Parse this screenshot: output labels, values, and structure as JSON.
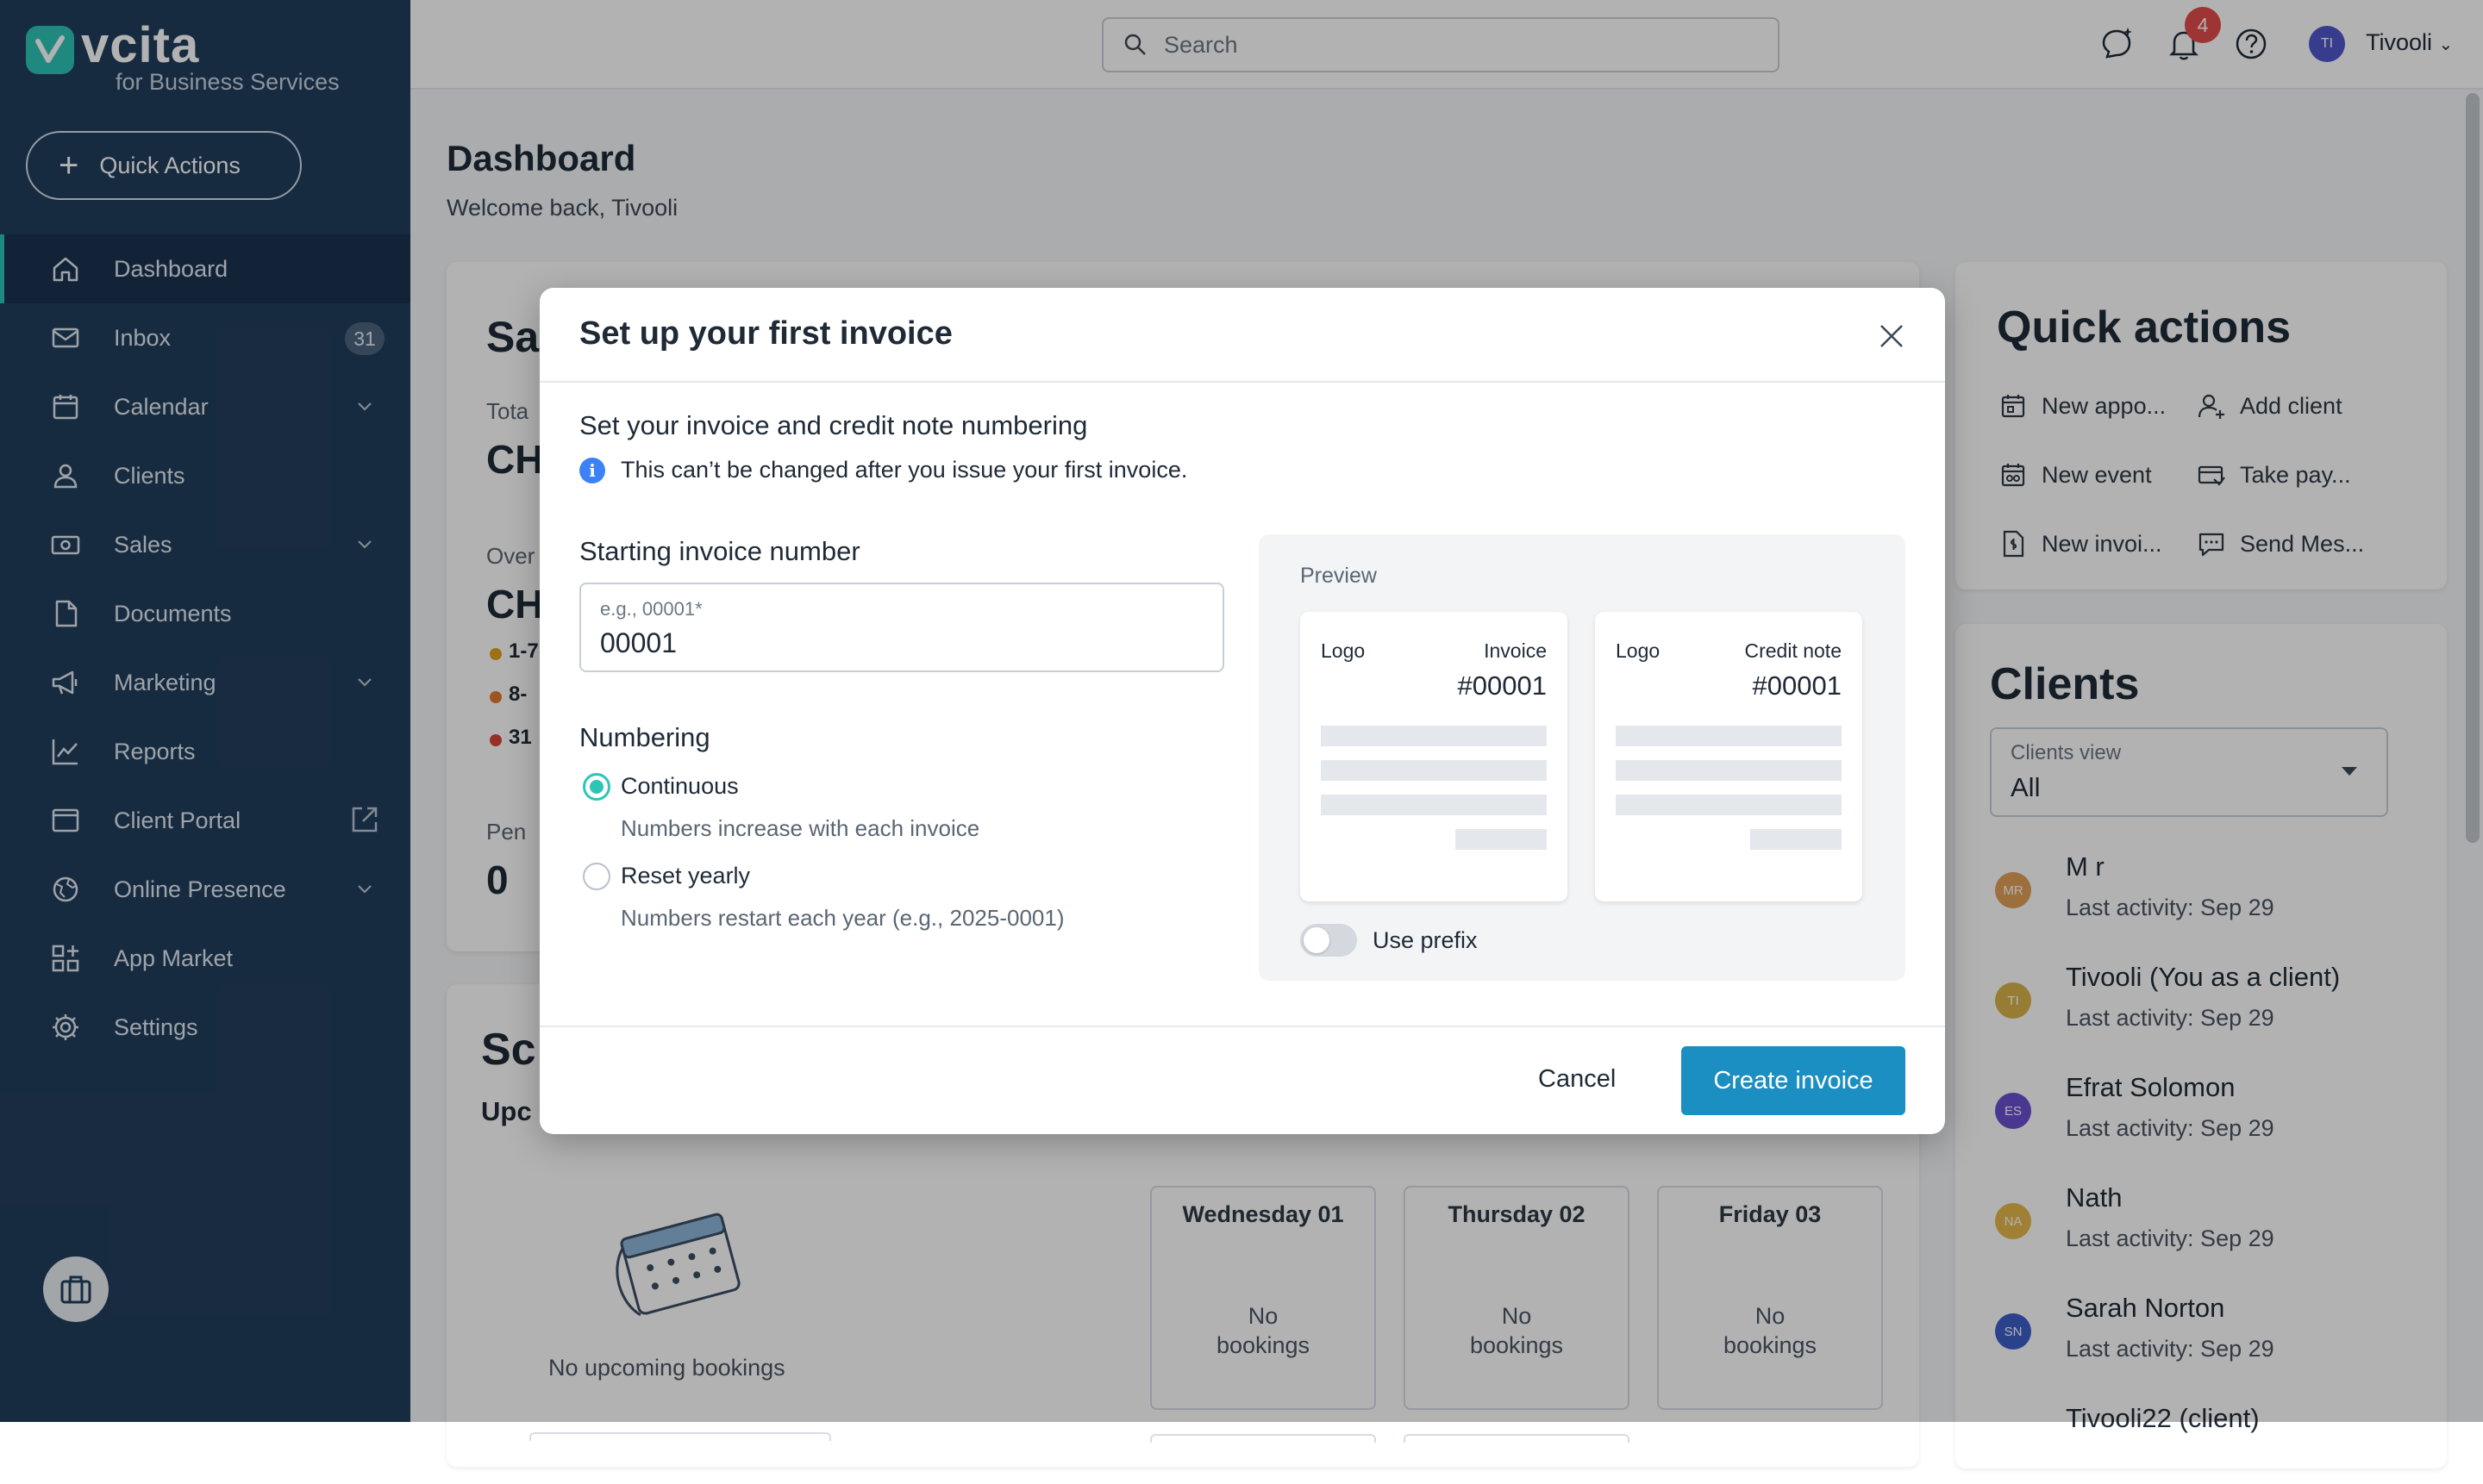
{
  "brand": {
    "name": "vcita",
    "subtitle": "for Business Services"
  },
  "sidebar": {
    "quick_actions": "Quick Actions",
    "items": [
      {
        "label": "Dashboard",
        "icon": "home-icon",
        "active": true
      },
      {
        "label": "Inbox",
        "icon": "inbox-icon",
        "badge": "31"
      },
      {
        "label": "Calendar",
        "icon": "calendar-icon",
        "expandable": true
      },
      {
        "label": "Clients",
        "icon": "person-icon"
      },
      {
        "label": "Sales",
        "icon": "money-icon",
        "expandable": true
      },
      {
        "label": "Documents",
        "icon": "document-icon"
      },
      {
        "label": "Marketing",
        "icon": "megaphone-icon",
        "expandable": true
      },
      {
        "label": "Reports",
        "icon": "chart-line-icon"
      },
      {
        "label": "Client Portal",
        "icon": "portal-icon",
        "external": true
      },
      {
        "label": "Online Presence",
        "icon": "globe-icon",
        "expandable": true
      },
      {
        "label": "App Market",
        "icon": "apps-icon"
      },
      {
        "label": "Settings",
        "icon": "gear-icon"
      }
    ]
  },
  "topbar": {
    "search_placeholder": "Search",
    "notifications_count": "4",
    "user_initials": "TI",
    "user_name": "Tivooli"
  },
  "dashboard": {
    "title": "Dashboard",
    "welcome": "Welcome back, Tivooli",
    "sales": {
      "title": "Sa",
      "total_label": "Tota",
      "total_value": "CH",
      "overdue_label": "Over",
      "overdue_value": "CH",
      "legend": [
        {
          "label": "1-7",
          "color": "#e0a21d"
        },
        {
          "label": "8-",
          "color": "#e07a2e"
        },
        {
          "label": "31",
          "color": "#d9443b"
        }
      ],
      "pending_label": "Pen",
      "pending_value": "0"
    },
    "schedule": {
      "title": "Sc",
      "subtitle": "Upc",
      "no_upcoming": "No upcoming bookings",
      "days": [
        {
          "name": "Wednesday 01",
          "empty_line1": "No",
          "empty_line2": "bookings"
        },
        {
          "name": "Thursday 02",
          "empty_line1": "No",
          "empty_line2": "bookings"
        },
        {
          "name": "Friday 03",
          "empty_line1": "No",
          "empty_line2": "bookings"
        }
      ]
    },
    "quick_actions": {
      "title": "Quick actions",
      "items": [
        {
          "label": "New appo...",
          "icon": "calendar-icon"
        },
        {
          "label": "Add client",
          "icon": "add-person-icon"
        },
        {
          "label": "New event",
          "icon": "event-icon"
        },
        {
          "label": "Take pay...",
          "icon": "payment-icon"
        },
        {
          "label": "New invoi...",
          "icon": "invoice-icon"
        },
        {
          "label": "Send Mes...",
          "icon": "message-icon"
        }
      ]
    },
    "clients": {
      "title": "Clients",
      "view_label": "Clients view",
      "view_value": "All",
      "list": [
        {
          "initials": "MR",
          "name": "M r",
          "activity": "Last activity: Sep 29",
          "color": "#e0a056"
        },
        {
          "initials": "TI",
          "name": "Tivooli (You as a client)",
          "activity": "Last activity: Sep 29",
          "color": "#d9b24a"
        },
        {
          "initials": "ES",
          "name": "Efrat Solomon",
          "activity": "Last activity: Sep 29",
          "color": "#6b4fcf"
        },
        {
          "initials": "NA",
          "name": "Nath",
          "activity": "Last activity: Sep 29",
          "color": "#e6b84d"
        },
        {
          "initials": "SN",
          "name": "Sarah Norton",
          "activity": "Last activity: Sep 29",
          "color": "#3d5fc9"
        },
        {
          "initials": "",
          "name": "Tivooli22 (client)",
          "activity": "",
          "color": "#ffffff"
        }
      ]
    }
  },
  "modal": {
    "title": "Set up your first invoice",
    "section_title": "Set your invoice and credit note numbering",
    "info_text": "This can’t be changed after you issue your first invoice.",
    "starting_label": "Starting invoice number",
    "input_placeholder": "e.g., 00001*",
    "input_value": "00001",
    "numbering_label": "Numbering",
    "options": [
      {
        "label": "Continuous",
        "description": "Numbers increase with each invoice",
        "selected": true
      },
      {
        "label": "Reset yearly",
        "description": "Numbers restart each year (e.g., 2025-0001)",
        "selected": false
      }
    ],
    "preview": {
      "label": "Preview",
      "invoice": {
        "logo": "Logo",
        "type": "Invoice",
        "number": "#00001"
      },
      "credit_note": {
        "logo": "Logo",
        "type": "Credit note",
        "number": "#00001"
      },
      "use_prefix_label": "Use prefix",
      "use_prefix_on": false
    },
    "cancel": "Cancel",
    "create": "Create invoice"
  },
  "colors": {
    "sidebar_bg": "#223e5c",
    "accent": "#2ec5b6",
    "primary_button": "#1b8ec2",
    "badge_red": "#e24c4c"
  }
}
